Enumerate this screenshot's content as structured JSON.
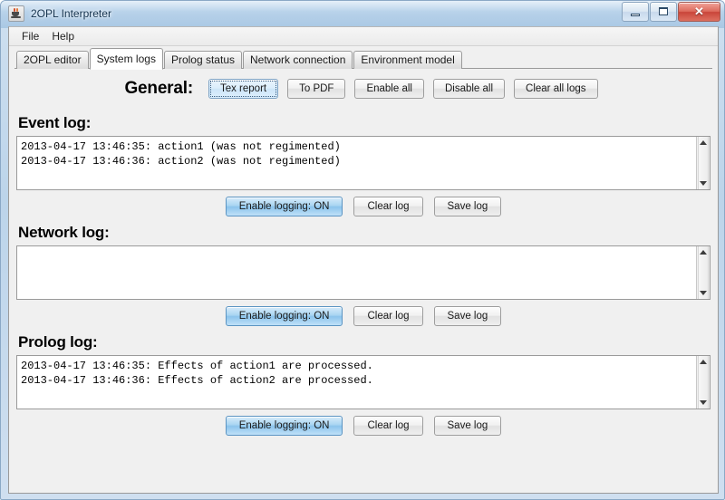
{
  "window": {
    "title": "2OPL Interpreter",
    "icon": "java-coffee-cup-icon",
    "controls": {
      "minimize_label": "–",
      "maximize_label": "□",
      "close_label": "✕"
    }
  },
  "menu": {
    "items": [
      {
        "label": "File"
      },
      {
        "label": "Help"
      }
    ]
  },
  "tabs": [
    {
      "label": "2OPL editor",
      "active": false
    },
    {
      "label": "System logs",
      "active": true
    },
    {
      "label": "Prolog status",
      "active": false
    },
    {
      "label": "Network connection",
      "active": false
    },
    {
      "label": "Environment model",
      "active": false
    }
  ],
  "general": {
    "label": "General:",
    "buttons": [
      {
        "label": "Tex report",
        "state": "focused"
      },
      {
        "label": "To PDF",
        "state": "normal"
      },
      {
        "label": "Enable all",
        "state": "normal"
      },
      {
        "label": "Disable all",
        "state": "normal"
      },
      {
        "label": "Clear all logs",
        "state": "normal"
      }
    ]
  },
  "sections": [
    {
      "title": "Event log:",
      "lines": "2013-04-17 13:46:35: action1 (was not regimented)\n2013-04-17 13:46:36: action2 (was not regimented)",
      "buttons": {
        "enable": "Enable logging:  ON",
        "clear": "Clear log",
        "save": "Save log"
      }
    },
    {
      "title": "Network log:",
      "lines": "",
      "buttons": {
        "enable": "Enable logging:  ON",
        "clear": "Clear log",
        "save": "Save log"
      }
    },
    {
      "title": "Prolog log:",
      "lines": "2013-04-17 13:46:35: Effects of action1 are processed.\n2013-04-17 13:46:36: Effects of action2 are processed.",
      "buttons": {
        "enable": "Enable logging:  ON",
        "clear": "Clear log",
        "save": "Save log"
      }
    }
  ],
  "colors": {
    "accent_blue": "#8bc4ec",
    "focus_blue": "#cde5f8",
    "frame_blue": "#b4cfe8",
    "close_red": "#c9453a",
    "panel_gray": "#f0f0f0"
  }
}
